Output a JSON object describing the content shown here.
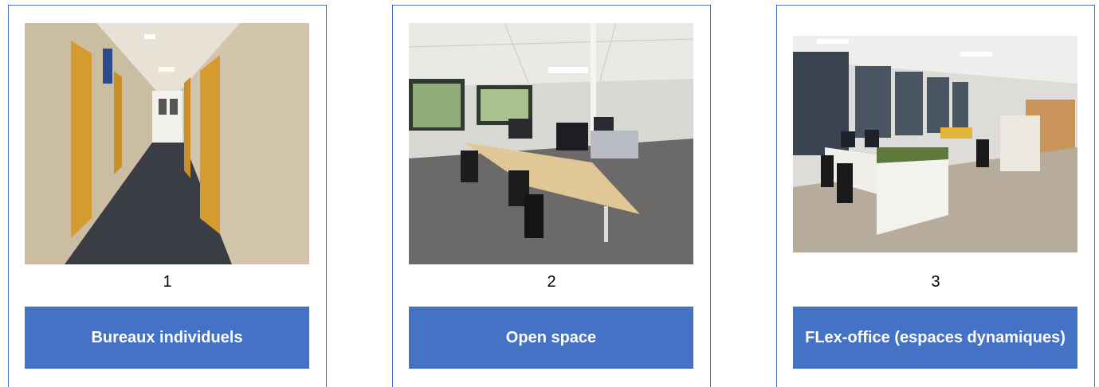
{
  "cards": [
    {
      "number": "1",
      "label": "Bureaux individuels",
      "photo_icon": "corridor-photo"
    },
    {
      "number": "2",
      "label": "Open space",
      "photo_icon": "open-space-photo"
    },
    {
      "number": "3",
      "label": "FLex-office (espaces dynamiques)",
      "photo_icon": "flex-office-photo"
    }
  ],
  "colors": {
    "accent": "#4472c4",
    "button_text": "#ffffff",
    "text": "#000000"
  }
}
